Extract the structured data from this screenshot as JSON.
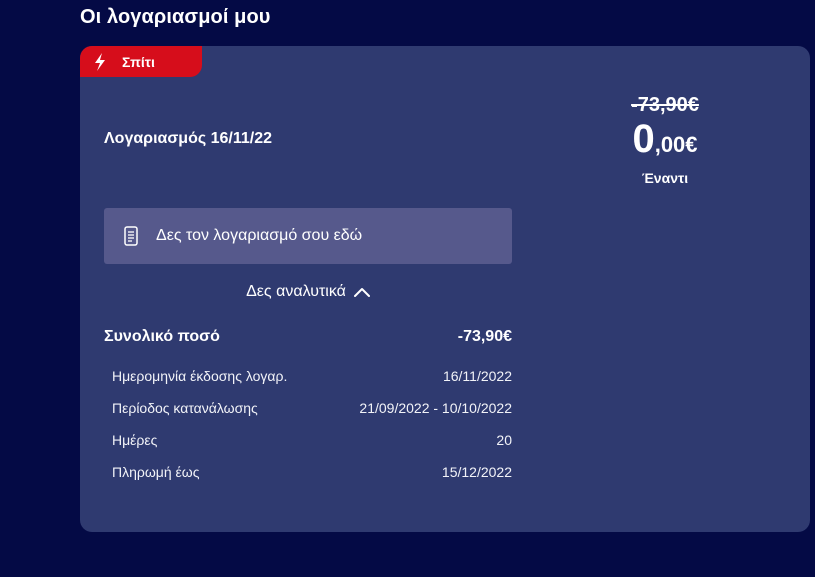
{
  "page": {
    "title": "Οι λογαριασμοί μου"
  },
  "card": {
    "tag": {
      "label": "Σπίτι",
      "icon": "lightning-bolt-icon",
      "color": "#d60d1b"
    },
    "account_title": "Λογαριασμός 16/11/22",
    "amounts": {
      "original": "-73,90€",
      "current_integer": "0",
      "current_decimal": ",00€",
      "caption": "Έναντι"
    },
    "view_bill": {
      "label": "Δες τον λογαριασμό σου εδώ",
      "icon": "document-icon"
    },
    "details_toggle": {
      "label": "Δες αναλυτικά",
      "icon": "chevron-up-icon"
    },
    "summary": {
      "total_label": "Συνολικό ποσό",
      "total_value": "-73,90€",
      "rows": [
        {
          "label": "Ημερομηνία έκδοσης λογαρ.",
          "value": "16/11/2022"
        },
        {
          "label": "Περίοδος κατανάλωσης",
          "value": "21/09/2022 - 10/10/2022"
        },
        {
          "label": "Ημέρες",
          "value": "20"
        },
        {
          "label": "Πληρωμή έως",
          "value": "15/12/2022"
        }
      ]
    }
  },
  "colors": {
    "background": "#040a45",
    "card": "#2f3a70",
    "button": "#56598c",
    "accent": "#d60d1b"
  }
}
